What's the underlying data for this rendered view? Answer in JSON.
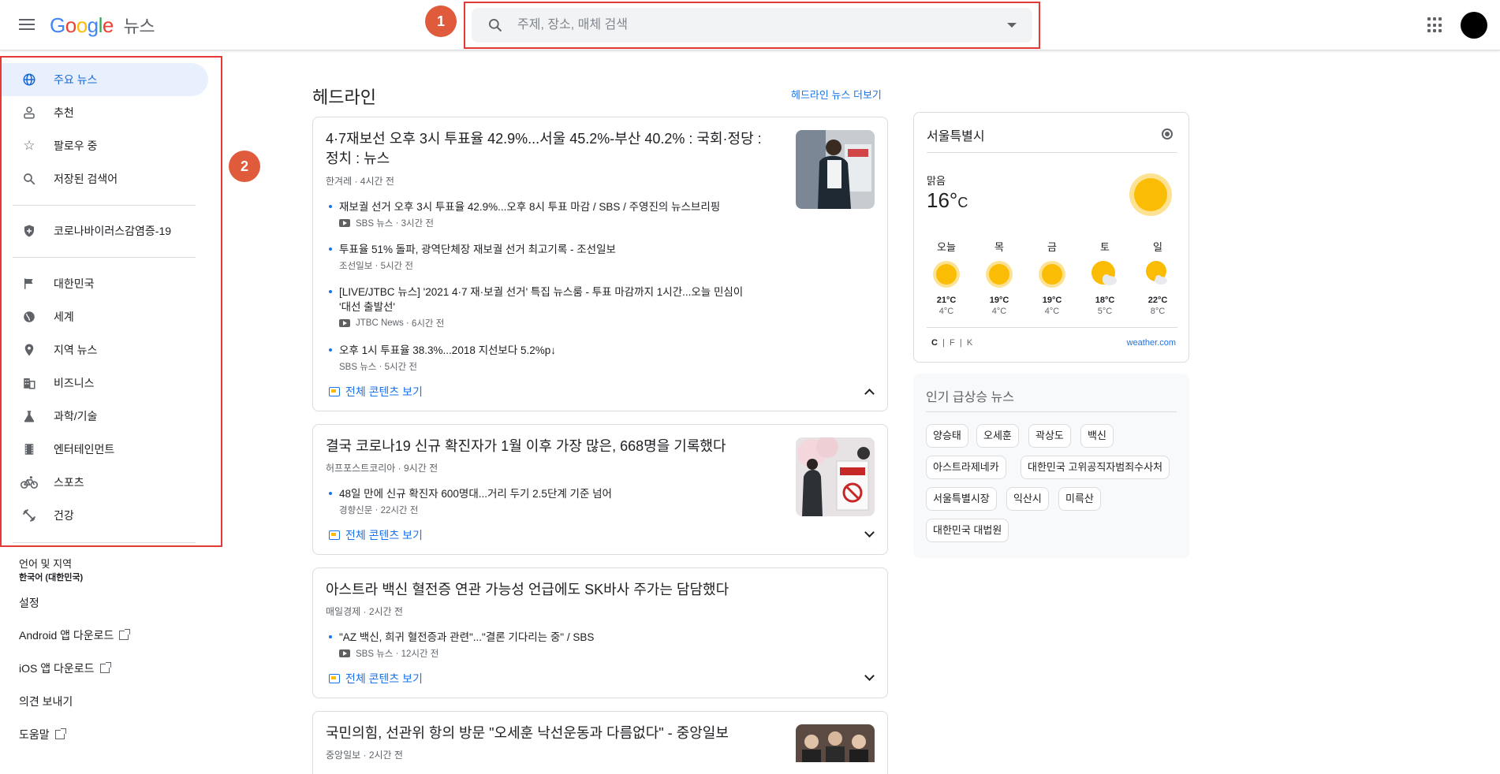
{
  "header": {
    "logo_google": [
      "G",
      "o",
      "o",
      "g",
      "l",
      "e"
    ],
    "logo_news": "뉴스",
    "search_placeholder": "주제, 장소, 매체 검색",
    "badge1": "1",
    "badge2": "2"
  },
  "sidebar": {
    "items": [
      {
        "label": "주요 뉴스",
        "icon": "globe-icon"
      },
      {
        "label": "추천",
        "icon": "person-icon"
      },
      {
        "label": "팔로우 중",
        "icon": "star-icon"
      },
      {
        "label": "저장된 검색어",
        "icon": "search-icon"
      },
      {
        "label": "코로나바이러스감염증-19",
        "icon": "shield-icon"
      },
      {
        "label": "대한민국",
        "icon": "flag-icon"
      },
      {
        "label": "세계",
        "icon": "world-icon"
      },
      {
        "label": "지역 뉴스",
        "icon": "location-icon"
      },
      {
        "label": "비즈니스",
        "icon": "building-icon"
      },
      {
        "label": "과학/기술",
        "icon": "flask-icon"
      },
      {
        "label": "엔터테인먼트",
        "icon": "film-icon"
      },
      {
        "label": "스포츠",
        "icon": "bike-icon"
      },
      {
        "label": "건강",
        "icon": "fitness-icon"
      }
    ],
    "lang_title": "언어 및 지역",
    "lang_value": "한국어 (대한민국)",
    "settings": "설정",
    "android": "Android 앱 다운로드",
    "ios": "iOS 앱 다운로드",
    "feedback": "의견 보내기",
    "help": "도움말"
  },
  "main": {
    "title": "헤드라인",
    "more": "헤드라인 뉴스 더보기",
    "full_coverage": "전체 콘텐츠 보기",
    "cards": [
      {
        "title": "4·7재보선 오후 3시 투표율 42.9%...서울 45.2%-부산 40.2% : 국회·정당 : 정치 : 뉴스",
        "source": "한겨레",
        "time": "4시간 전",
        "subs": [
          {
            "title": "재보궐 선거 오후 3시 투표율 42.9%...오후 8시 투표 마감 / SBS / 주영진의 뉴스브리핑",
            "source": "SBS 뉴스",
            "time": "3시간 전",
            "video": true
          },
          {
            "title": "투표율 51% 돌파, 광역단체장 재보궐 선거 최고기록 - 조선일보",
            "source": "조선일보",
            "time": "5시간 전",
            "video": false
          },
          {
            "title": "[LIVE/JTBC 뉴스] '2021 4·7 재·보궐 선거' 특집 뉴스룸 - 투표 마감까지 1시간...오늘 민심이 '대선 출발선'",
            "source": "JTBC News",
            "time": "6시간 전",
            "video": true
          },
          {
            "title": "오후 1시 투표율 38.3%...2018 지선보다 5.2%p↓",
            "source": "SBS 뉴스",
            "time": "5시간 전",
            "video": false
          }
        ]
      },
      {
        "title": "결국 코로나19 신규 확진자가 1월 이후 가장 많은, 668명을 기록했다",
        "source": "허프포스트코리아",
        "time": "9시간 전",
        "subs": [
          {
            "title": "48일 만에 신규 확진자 600명대...거리 두기 2.5단계 기준 넘어",
            "source": "경향신문",
            "time": "22시간 전",
            "video": false
          }
        ]
      },
      {
        "title": "아스트라 백신 혈전증 연관 가능성 언급에도 SK바사 주가는 담담했다",
        "source": "매일경제",
        "time": "2시간 전",
        "subs": [
          {
            "title": "\"AZ 백신, 희귀 혈전증과 관련\"...\"결론 기다리는 중\" / SBS",
            "source": "SBS 뉴스",
            "time": "12시간 전",
            "video": true
          }
        ]
      },
      {
        "title": "국민의힘, 선관위 항의 방문 \"오세훈 낙선운동과 다름없다\" - 중앙일보",
        "source": "중앙일보",
        "time": "2시간 전",
        "subs": []
      }
    ]
  },
  "weather": {
    "city": "서울특별시",
    "condition": "맑음",
    "temp": "16°",
    "unit": "C",
    "days": [
      {
        "d": "오늘",
        "hi": "21°C",
        "lo": "4°C",
        "icon": "sun-icon"
      },
      {
        "d": "목",
        "hi": "19°C",
        "lo": "4°C",
        "icon": "sun-icon"
      },
      {
        "d": "금",
        "hi": "19°C",
        "lo": "4°C",
        "icon": "sun-icon"
      },
      {
        "d": "토",
        "hi": "18°C",
        "lo": "5°C",
        "icon": "partly-cloudy-icon"
      },
      {
        "d": "일",
        "hi": "22°C",
        "lo": "8°C",
        "icon": "partly-cloudy-icon"
      }
    ],
    "units": [
      "C",
      "F",
      "K"
    ],
    "source": "weather.com"
  },
  "trending": {
    "title": "인기 급상승 뉴스",
    "chips": [
      "양승태",
      "오세훈",
      "곽상도",
      "백신",
      "아스트라제네카",
      "대한민국 고위공직자범죄수사처",
      "서울특별시장",
      "익산시",
      "미륵산",
      "대한민국 대법원"
    ]
  },
  "colors": {
    "accent": "#1a73e8",
    "highlight_border": "#e53935",
    "badge": "#e05b3c",
    "active_nav_bg": "#e8f0fe"
  }
}
